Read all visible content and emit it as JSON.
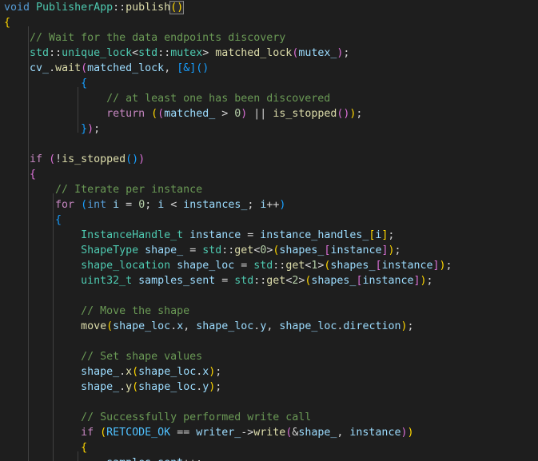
{
  "theme": {
    "background": "#1e1e1e",
    "indent_guide": "#404040",
    "colors": {
      "kw": "#569cd6",
      "ctl": "#c586c0",
      "ty": "#4ec9b0",
      "fn": "#dcdcaa",
      "var": "#9cdcfe",
      "cm": "#6a9955",
      "num": "#b5cea8",
      "bracket1": "#ffd700",
      "bracket2": "#da70d6",
      "bracket3": "#179fff"
    }
  },
  "code": {
    "language": "cpp",
    "lines": [
      [
        [
          "kw",
          "void"
        ],
        [
          "tx",
          " "
        ],
        [
          "ty",
          "PublisherApp"
        ],
        [
          "op",
          "::"
        ],
        [
          "fn",
          "publish"
        ],
        [
          "p1m",
          "()"
        ]
      ],
      [
        [
          "p1",
          "{"
        ]
      ],
      [
        [
          "tx",
          "    "
        ],
        [
          "cm",
          "// Wait for the data endpoints discovery"
        ]
      ],
      [
        [
          "tx",
          "    "
        ],
        [
          "ty",
          "std"
        ],
        [
          "op",
          "::"
        ],
        [
          "ty",
          "unique_lock"
        ],
        [
          "op",
          "<"
        ],
        [
          "ty",
          "std"
        ],
        [
          "op",
          "::"
        ],
        [
          "ty",
          "mutex"
        ],
        [
          "op",
          "> "
        ],
        [
          "fn",
          "matched_lock"
        ],
        [
          "p2",
          "("
        ],
        [
          "var",
          "mutex_"
        ],
        [
          "p2",
          ")"
        ],
        [
          "op",
          ";"
        ]
      ],
      [
        [
          "tx",
          "    "
        ],
        [
          "var",
          "cv_"
        ],
        [
          "op",
          "."
        ],
        [
          "fn",
          "wait"
        ],
        [
          "p2",
          "("
        ],
        [
          "var",
          "matched_lock"
        ],
        [
          "op",
          ", "
        ],
        [
          "p3",
          "[&]"
        ],
        [
          "p3",
          "()"
        ]
      ],
      [
        [
          "tx",
          "            "
        ],
        [
          "p3",
          "{"
        ]
      ],
      [
        [
          "tx",
          "                "
        ],
        [
          "cm",
          "// at least one has been discovered"
        ]
      ],
      [
        [
          "tx",
          "                "
        ],
        [
          "ctl",
          "return"
        ],
        [
          "tx",
          " "
        ],
        [
          "p1",
          "("
        ],
        [
          "p2",
          "("
        ],
        [
          "var",
          "matched_"
        ],
        [
          "op",
          " > "
        ],
        [
          "num",
          "0"
        ],
        [
          "p2",
          ")"
        ],
        [
          "op",
          " || "
        ],
        [
          "fn",
          "is_stopped"
        ],
        [
          "p2",
          "()"
        ],
        [
          "p1",
          ")"
        ],
        [
          "op",
          ";"
        ]
      ],
      [
        [
          "tx",
          "            "
        ],
        [
          "p3",
          "}"
        ],
        [
          "p2",
          ")"
        ],
        [
          "op",
          ";"
        ]
      ],
      [],
      [
        [
          "tx",
          "    "
        ],
        [
          "ctl",
          "if"
        ],
        [
          "tx",
          " "
        ],
        [
          "p2",
          "("
        ],
        [
          "op",
          "!"
        ],
        [
          "fn",
          "is_stopped"
        ],
        [
          "p3",
          "()"
        ],
        [
          "p2",
          ")"
        ]
      ],
      [
        [
          "tx",
          "    "
        ],
        [
          "p2",
          "{"
        ]
      ],
      [
        [
          "tx",
          "        "
        ],
        [
          "cm",
          "// Iterate per instance"
        ]
      ],
      [
        [
          "tx",
          "        "
        ],
        [
          "ctl",
          "for"
        ],
        [
          "tx",
          " "
        ],
        [
          "p3",
          "("
        ],
        [
          "kw",
          "int"
        ],
        [
          "tx",
          " "
        ],
        [
          "var",
          "i"
        ],
        [
          "op",
          " = "
        ],
        [
          "num",
          "0"
        ],
        [
          "op",
          "; "
        ],
        [
          "var",
          "i"
        ],
        [
          "op",
          " < "
        ],
        [
          "var",
          "instances_"
        ],
        [
          "op",
          "; "
        ],
        [
          "var",
          "i"
        ],
        [
          "op",
          "++"
        ],
        [
          "p3",
          ")"
        ]
      ],
      [
        [
          "tx",
          "        "
        ],
        [
          "p3",
          "{"
        ]
      ],
      [
        [
          "tx",
          "            "
        ],
        [
          "ty",
          "InstanceHandle_t"
        ],
        [
          "tx",
          " "
        ],
        [
          "var",
          "instance"
        ],
        [
          "op",
          " = "
        ],
        [
          "var",
          "instance_handles_"
        ],
        [
          "p1",
          "["
        ],
        [
          "var",
          "i"
        ],
        [
          "p1",
          "]"
        ],
        [
          "op",
          ";"
        ]
      ],
      [
        [
          "tx",
          "            "
        ],
        [
          "ty",
          "ShapeType"
        ],
        [
          "tx",
          " "
        ],
        [
          "var",
          "shape_"
        ],
        [
          "op",
          " = "
        ],
        [
          "ty",
          "std"
        ],
        [
          "op",
          "::"
        ],
        [
          "fn",
          "get"
        ],
        [
          "op",
          "<"
        ],
        [
          "num",
          "0"
        ],
        [
          "op",
          ">"
        ],
        [
          "p1",
          "("
        ],
        [
          "var",
          "shapes_"
        ],
        [
          "p2",
          "["
        ],
        [
          "var",
          "instance"
        ],
        [
          "p2",
          "]"
        ],
        [
          "p1",
          ")"
        ],
        [
          "op",
          ";"
        ]
      ],
      [
        [
          "tx",
          "            "
        ],
        [
          "ty",
          "shape_location"
        ],
        [
          "tx",
          " "
        ],
        [
          "var",
          "shape_loc"
        ],
        [
          "op",
          " = "
        ],
        [
          "ty",
          "std"
        ],
        [
          "op",
          "::"
        ],
        [
          "fn",
          "get"
        ],
        [
          "op",
          "<"
        ],
        [
          "num",
          "1"
        ],
        [
          "op",
          ">"
        ],
        [
          "p1",
          "("
        ],
        [
          "var",
          "shapes_"
        ],
        [
          "p2",
          "["
        ],
        [
          "var",
          "instance"
        ],
        [
          "p2",
          "]"
        ],
        [
          "p1",
          ")"
        ],
        [
          "op",
          ";"
        ]
      ],
      [
        [
          "tx",
          "            "
        ],
        [
          "ty",
          "uint32_t"
        ],
        [
          "tx",
          " "
        ],
        [
          "var",
          "samples_sent"
        ],
        [
          "op",
          " = "
        ],
        [
          "ty",
          "std"
        ],
        [
          "op",
          "::"
        ],
        [
          "fn",
          "get"
        ],
        [
          "op",
          "<"
        ],
        [
          "num",
          "2"
        ],
        [
          "op",
          ">"
        ],
        [
          "p1",
          "("
        ],
        [
          "var",
          "shapes_"
        ],
        [
          "p2",
          "["
        ],
        [
          "var",
          "instance"
        ],
        [
          "p2",
          "]"
        ],
        [
          "p1",
          ")"
        ],
        [
          "op",
          ";"
        ]
      ],
      [],
      [
        [
          "tx",
          "            "
        ],
        [
          "cm",
          "// Move the shape"
        ]
      ],
      [
        [
          "tx",
          "            "
        ],
        [
          "fn",
          "move"
        ],
        [
          "p1",
          "("
        ],
        [
          "var",
          "shape_loc"
        ],
        [
          "op",
          "."
        ],
        [
          "var",
          "x"
        ],
        [
          "op",
          ", "
        ],
        [
          "var",
          "shape_loc"
        ],
        [
          "op",
          "."
        ],
        [
          "var",
          "y"
        ],
        [
          "op",
          ", "
        ],
        [
          "var",
          "shape_loc"
        ],
        [
          "op",
          "."
        ],
        [
          "var",
          "direction"
        ],
        [
          "p1",
          ")"
        ],
        [
          "op",
          ";"
        ]
      ],
      [],
      [
        [
          "tx",
          "            "
        ],
        [
          "cm",
          "// Set shape values"
        ]
      ],
      [
        [
          "tx",
          "            "
        ],
        [
          "var",
          "shape_"
        ],
        [
          "op",
          "."
        ],
        [
          "fn",
          "x"
        ],
        [
          "p1",
          "("
        ],
        [
          "var",
          "shape_loc"
        ],
        [
          "op",
          "."
        ],
        [
          "var",
          "x"
        ],
        [
          "p1",
          ")"
        ],
        [
          "op",
          ";"
        ]
      ],
      [
        [
          "tx",
          "            "
        ],
        [
          "var",
          "shape_"
        ],
        [
          "op",
          "."
        ],
        [
          "fn",
          "y"
        ],
        [
          "p1",
          "("
        ],
        [
          "var",
          "shape_loc"
        ],
        [
          "op",
          "."
        ],
        [
          "var",
          "y"
        ],
        [
          "p1",
          ")"
        ],
        [
          "op",
          ";"
        ]
      ],
      [],
      [
        [
          "tx",
          "            "
        ],
        [
          "cm",
          "// Successfully performed write call"
        ]
      ],
      [
        [
          "tx",
          "            "
        ],
        [
          "ctl",
          "if"
        ],
        [
          "tx",
          " "
        ],
        [
          "p1",
          "("
        ],
        [
          "en",
          "RETCODE_OK"
        ],
        [
          "op",
          " == "
        ],
        [
          "var",
          "writer_"
        ],
        [
          "op",
          "->"
        ],
        [
          "fn",
          "write"
        ],
        [
          "p2",
          "("
        ],
        [
          "op",
          "&"
        ],
        [
          "var",
          "shape_"
        ],
        [
          "op",
          ", "
        ],
        [
          "var",
          "instance"
        ],
        [
          "p2",
          ")"
        ],
        [
          "p1",
          ")"
        ]
      ],
      [
        [
          "tx",
          "            "
        ],
        [
          "p1",
          "{"
        ]
      ],
      [
        [
          "tx",
          "                "
        ],
        [
          "var",
          "samples_sent"
        ],
        [
          "op",
          "++;"
        ]
      ]
    ]
  }
}
